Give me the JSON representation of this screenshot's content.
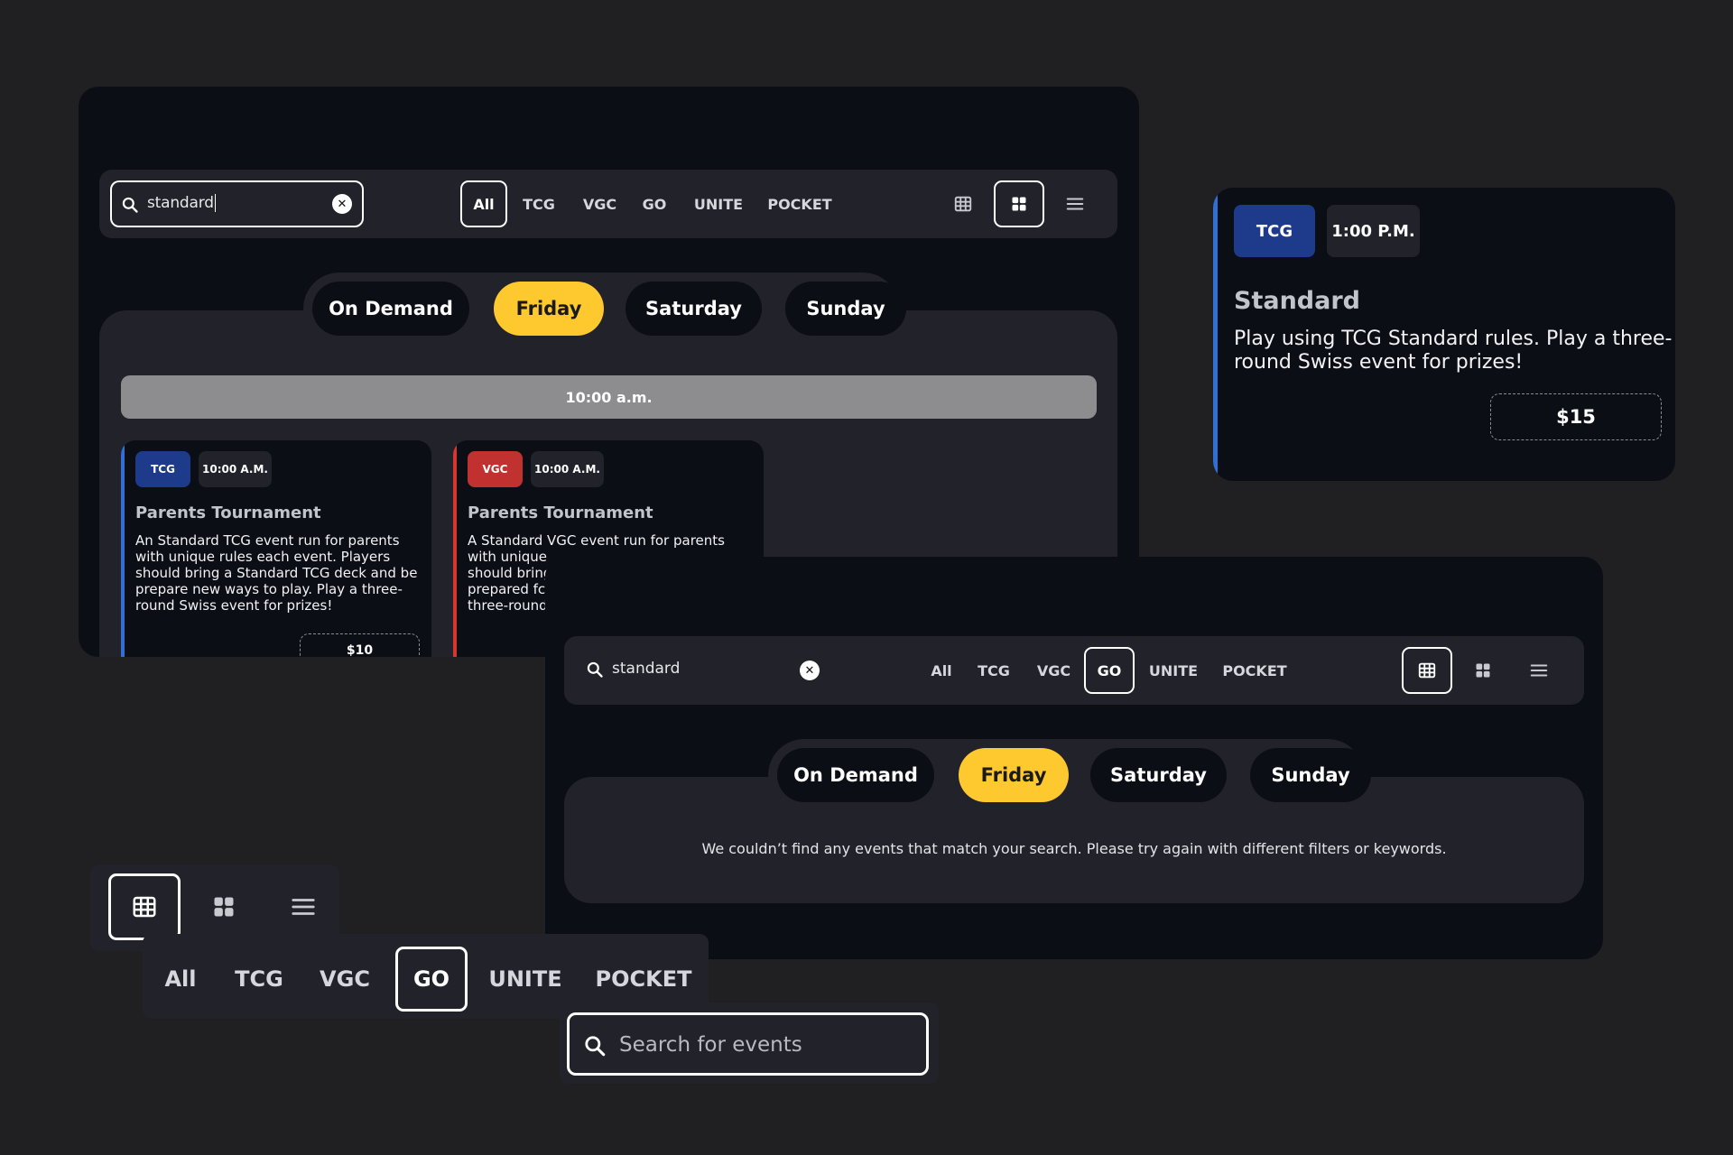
{
  "colors": {
    "page_bg": "#201f22",
    "panel_bg": "#0c0e16",
    "surface": "#21222a",
    "accent_yellow": "#fec82f",
    "tcg_blue": "#1e3a8a",
    "vgc_red": "#c0312f",
    "timebar": "#8d8d90"
  },
  "panel_results": {
    "search": {
      "value": "standard",
      "clear_icon": "close-icon",
      "search_icon": "search-icon"
    },
    "filters": [
      "All",
      "TCG",
      "VGC",
      "GO",
      "UNITE",
      "POCKET"
    ],
    "active_filter": "All",
    "view_icons": [
      "table-view-icon",
      "grid-view-icon",
      "list-view-icon"
    ],
    "active_view": "grid-view-icon",
    "day_tabs": [
      "On Demand",
      "Friday",
      "Saturday",
      "Sunday"
    ],
    "active_day": "Friday",
    "time_header": "10:00 a.m.",
    "cards": [
      {
        "category": "TCG",
        "time": "10:00 A.M.",
        "title": "Parents Tournament",
        "desc_lines": [
          "An Standard TCG event run for parents",
          "with unique rules each event. Players",
          "should bring a Standard TCG deck and be",
          "prepare new ways to play. Play a three-",
          "round Swiss event for prizes!"
        ],
        "price": "$10",
        "accent": "#2f6fd6",
        "tag_color": "#1e3a8a"
      },
      {
        "category": "VGC",
        "time": "10:00 A.M.",
        "title": "Parents Tournament",
        "desc_lines": [
          "A Standard VGC event run for parents",
          "with unique",
          "should bring",
          "prepared fc",
          "three-round"
        ],
        "accent": "#d9362f",
        "tag_color": "#c0312f"
      }
    ]
  },
  "panel_card_detail": {
    "category": "TCG",
    "time": "1:00 P.M.",
    "title": "Standard",
    "desc_lines": [
      "Play using TCG Standard rules. Play a three-",
      "round Swiss event for prizes!"
    ],
    "price": "$15"
  },
  "panel_empty": {
    "search": {
      "value": "standard"
    },
    "filters": [
      "All",
      "TCG",
      "VGC",
      "GO",
      "UNITE",
      "POCKET"
    ],
    "active_filter": "GO",
    "view_icons": [
      "table-view-icon",
      "grid-view-icon",
      "list-view-icon"
    ],
    "active_view": "table-view-icon",
    "day_tabs": [
      "On Demand",
      "Friday",
      "Saturday",
      "Sunday"
    ],
    "active_day": "Friday",
    "empty_message": "We couldn’t find any events that match your search. Please try again with different filters or keywords."
  },
  "sample_views": {
    "active_view": "table-view-icon"
  },
  "sample_filters": {
    "items": [
      "All",
      "TCG",
      "VGC",
      "GO",
      "UNITE",
      "POCKET"
    ],
    "active": "GO"
  },
  "sample_search": {
    "placeholder": "Search for events",
    "value": ""
  }
}
